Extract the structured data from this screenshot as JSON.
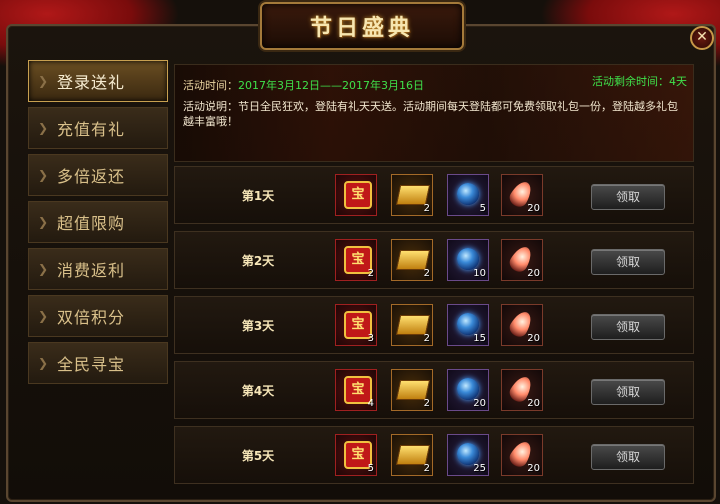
{
  "title": "节日盛典",
  "close_icon": "close-icon",
  "tabs": [
    {
      "label": "登录送礼",
      "active": true
    },
    {
      "label": "充值有礼",
      "active": false
    },
    {
      "label": "多倍返还",
      "active": false
    },
    {
      "label": "超值限购",
      "active": false
    },
    {
      "label": "消费返利",
      "active": false
    },
    {
      "label": "双倍积分",
      "active": false
    },
    {
      "label": "全民寻宝",
      "active": false
    }
  ],
  "banner": {
    "time_label": "活动时间：",
    "time_value": "2017年3月12日——2017年3月16日",
    "remain": "活动剩余时间：4天",
    "desc": "活动说明：节日全民狂欢，登陆有礼天天送。活动期间每天登陆都可免费领取礼包一份，登陆越多礼包越丰富哦！"
  },
  "rows": [
    {
      "day": "第1天",
      "items": [
        {
          "icon": "treasure-seal-icon",
          "count": ""
        },
        {
          "icon": "gold-ingot-icon",
          "count": "2"
        },
        {
          "icon": "blue-orb-icon",
          "count": "5"
        },
        {
          "icon": "feather-icon",
          "count": "20"
        }
      ],
      "button": "领取"
    },
    {
      "day": "第2天",
      "items": [
        {
          "icon": "treasure-seal-icon",
          "count": "2"
        },
        {
          "icon": "gold-ingot-icon",
          "count": "2"
        },
        {
          "icon": "blue-orb-icon",
          "count": "10"
        },
        {
          "icon": "feather-icon",
          "count": "20"
        }
      ],
      "button": "领取"
    },
    {
      "day": "第3天",
      "items": [
        {
          "icon": "treasure-seal-icon",
          "count": "3"
        },
        {
          "icon": "gold-ingot-icon",
          "count": "2"
        },
        {
          "icon": "blue-orb-icon",
          "count": "15"
        },
        {
          "icon": "feather-icon",
          "count": "20"
        }
      ],
      "button": "领取"
    },
    {
      "day": "第4天",
      "items": [
        {
          "icon": "treasure-seal-icon",
          "count": "4"
        },
        {
          "icon": "gold-ingot-icon",
          "count": "2"
        },
        {
          "icon": "blue-orb-icon",
          "count": "20"
        },
        {
          "icon": "feather-icon",
          "count": "20"
        }
      ],
      "button": "领取"
    },
    {
      "day": "第5天",
      "items": [
        {
          "icon": "treasure-seal-icon",
          "count": "5"
        },
        {
          "icon": "gold-ingot-icon",
          "count": "2"
        },
        {
          "icon": "blue-orb-icon",
          "count": "25"
        },
        {
          "icon": "feather-icon",
          "count": "20"
        }
      ],
      "button": "领取"
    }
  ],
  "seal_glyph": "宝",
  "colors": {
    "accent_green": "#3fe04a",
    "gold_text": "#f7e6b0",
    "ribbon_red": "#b01818"
  }
}
